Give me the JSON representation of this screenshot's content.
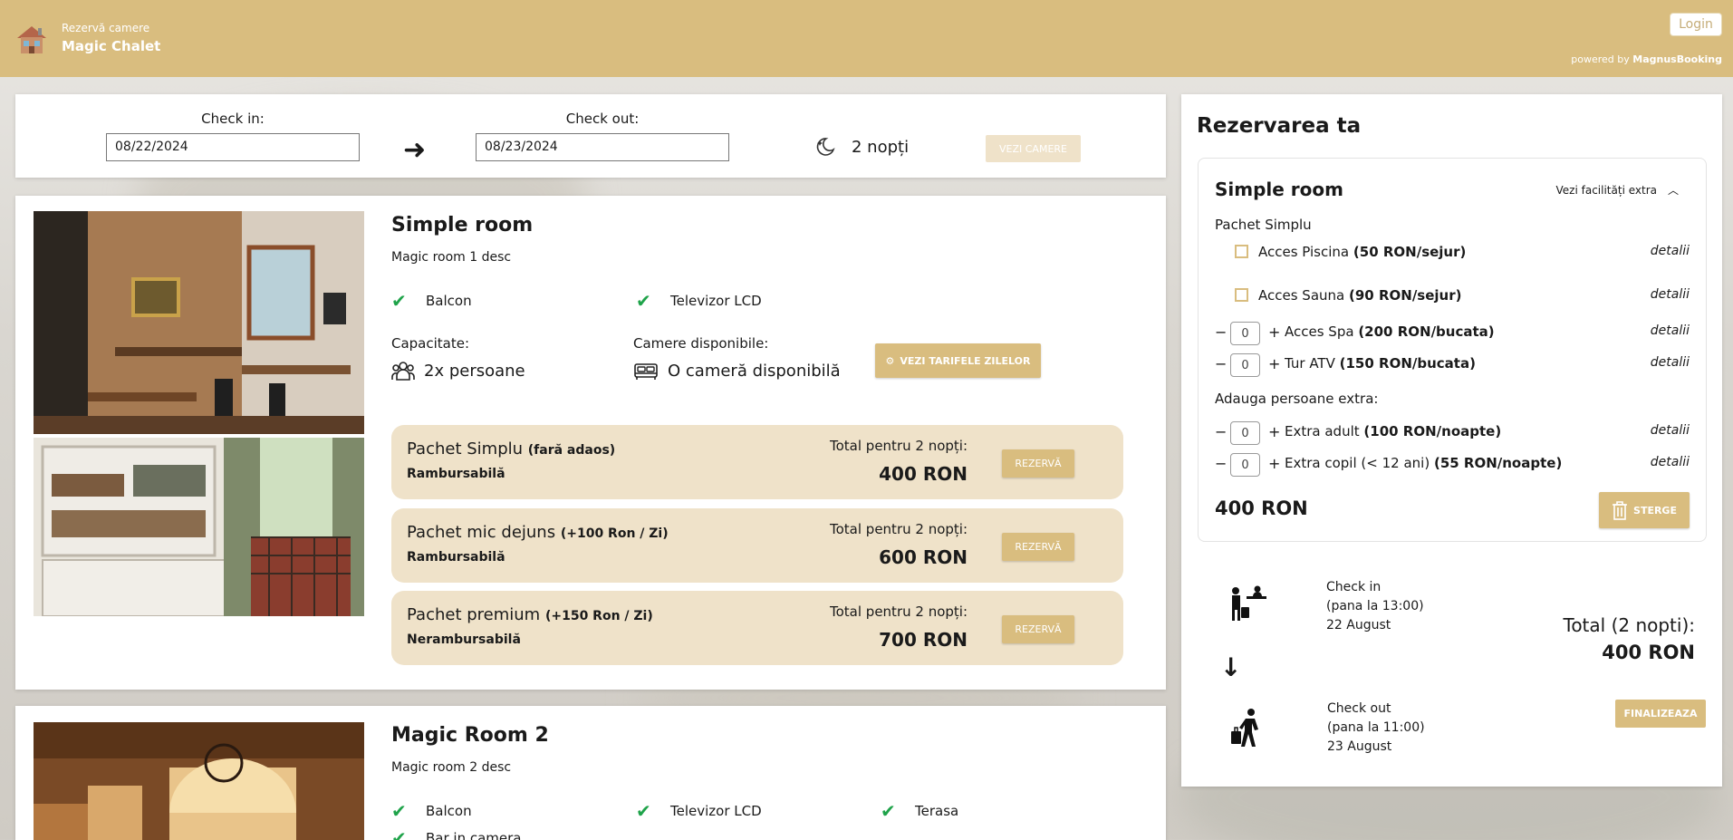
{
  "header": {
    "brand_sub": "Rezervă camere",
    "brand_title": "Magic Chalet",
    "login": "Login",
    "powered_prefix": "powered by ",
    "powered_brand": "MagnusBooking"
  },
  "search": {
    "checkin_label": "Check in:",
    "checkin_value": "08/22/2024",
    "checkout_label": "Check out:",
    "checkout_value": "08/23/2024",
    "nights": "2 nopți",
    "see_rooms": "VEZI CAMERE"
  },
  "rooms": [
    {
      "title": "Simple room",
      "desc": "Magic room 1 desc",
      "amenities": [
        "Balcon",
        "Televizor LCD"
      ],
      "capacity_label": "Capacitate:",
      "capacity_value": "2x persoane",
      "available_label": "Camere disponibile:",
      "available_value": "O cameră disponibilă",
      "tarife_button": "VEZI TARIFELE ZILELOR",
      "packages": [
        {
          "name": "Pachet Simplu",
          "extra": "(fară adaos)",
          "policy": "Rambursabilă",
          "total_label": "Total pentru 2 nopți:",
          "price": "400 RON",
          "button": "REZERVĂ"
        },
        {
          "name": "Pachet mic dejuns",
          "extra": "(+100 Ron / Zi)",
          "policy": "Rambursabilă",
          "total_label": "Total pentru 2 nopți:",
          "price": "600 RON",
          "button": "REZERVĂ"
        },
        {
          "name": "Pachet premium",
          "extra": "(+150 Ron / Zi)",
          "policy": "Nerambursabilă",
          "total_label": "Total pentru 2 nopți:",
          "price": "700 RON",
          "button": "REZERVĂ"
        }
      ]
    },
    {
      "title": "Magic Room 2",
      "desc": "Magic room 2 desc",
      "amenities": [
        "Balcon",
        "Televizor LCD",
        "Terasa",
        "Bar in camera"
      ]
    }
  ],
  "reservation": {
    "title": "Rezervarea ta",
    "room_title": "Simple room",
    "extras_toggle": "Vezi facilități extra",
    "package_name": "Pachet Simplu",
    "options": [
      {
        "label": "Acces Piscina",
        "price": "(50 RON/sejur)",
        "details": "detalii"
      },
      {
        "label": "Acces Sauna",
        "price": "(90 RON/sejur)",
        "details": "detalii"
      }
    ],
    "counters": [
      {
        "label": "Acces Spa",
        "price": "(200 RON/bucata)",
        "qty": "0",
        "details": "detalii"
      },
      {
        "label": "Tur ATV",
        "price": "(150 RON/bucata)",
        "qty": "0",
        "details": "detalii"
      }
    ],
    "extra_persons_label": "Adauga persoane extra:",
    "extra_persons": [
      {
        "label": "Extra adult",
        "price": "(100 RON/noapte)",
        "qty": "0",
        "details": "detalii"
      },
      {
        "label": "Extra copil (< 12 ani)",
        "price": "(55 RON/noapte)",
        "qty": "0",
        "details": "detalii"
      }
    ],
    "subtotal": "400 RON",
    "delete_button": "STERGE",
    "checkin": {
      "title": "Check in",
      "time": "(pana la 13:00)",
      "date": "22 August"
    },
    "checkout": {
      "title": "Check out",
      "time": "(pana la 11:00)",
      "date": "23 August"
    },
    "total_label": "Total (2 nopti):",
    "total_value": "400 RON",
    "finalize_button": "FINALIZEAZA"
  }
}
